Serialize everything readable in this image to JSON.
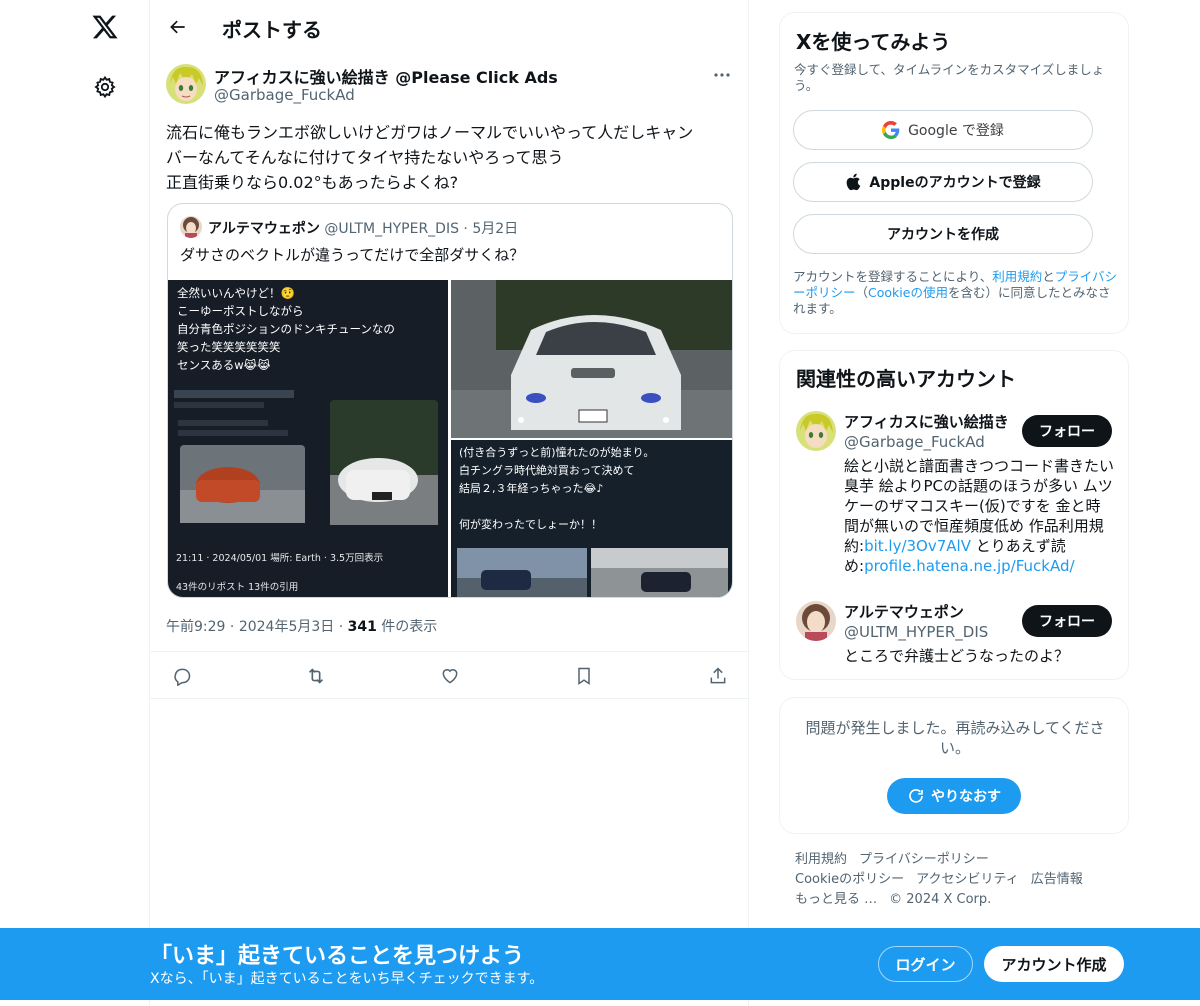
{
  "nav": {
    "logo_icon": "x-logo-icon",
    "settings_icon": "gear-icon"
  },
  "header": {
    "title": "ポストする",
    "back_icon": "arrow-left-icon"
  },
  "post": {
    "author_name": "アフィカスに強い絵描き @Please Click Ads",
    "author_handle": "@Garbage_FuckAd",
    "text_lines": [
      "流石に俺もランエボ欲しいけどガワはノーマルでいいやって人だしキャン",
      "バーなんてそんなに付けてタイヤ持たないやろって思う",
      "正直街乗りなら0.02°もあったらよくね?"
    ],
    "quote": {
      "name": "アルテマウェポン",
      "handle": "@ULTM_HYPER_DIS",
      "separator": "·",
      "date": "5月2日",
      "text": "ダサさのベクトルが違うってだけで全部ダサくね？",
      "media1_lines": [
        "全然いいんやけど！🤨",
        "こーゆーポストしながら",
        "自分青色ポジションのドンキチューンなの",
        "笑った笑笑笑笑笑笑",
        "センスあるw😹😹"
      ],
      "media1_footer": "21:11 · 2024/05/01 場所: Earth · 3.5万回表示",
      "media1_footer2": "43件のリポスト 13件の引用",
      "media3_lines": [
        "(付き合うずっと前)憧れたのが始まり。",
        "白チングラ時代絶対買おって決めて",
        "結局２,３年経っちゃった😂♪",
        "",
        "何が変わったでしょーか！！"
      ]
    },
    "time": "午前9:29",
    "date": "2024年5月3日",
    "views_count": "341",
    "views_label": " 件の表示",
    "dot": " · "
  },
  "actions": [
    "reply-icon",
    "repost-icon",
    "like-icon",
    "bookmark-icon",
    "share-icon"
  ],
  "signup_card": {
    "title": "Xを使ってみよう",
    "subtitle": "今すぐ登録して、タイムラインをカスタマイズしましょう。",
    "google": "Google で登録",
    "apple": "Appleのアカウントで登録",
    "create": "アカウントを作成",
    "terms_pre": "アカウントを登録することにより、",
    "terms_link1": "利用規約",
    "terms_and": "と",
    "terms_link2": "プライバシーポリシー",
    "terms_mid": "（",
    "terms_link3": "Cookieの使用",
    "terms_post": "を含む）に同意したとみなされます。"
  },
  "related": {
    "title": "関連性の高いアカウント",
    "accounts": [
      {
        "name": "アフィカスに強い絵描き",
        "handle": "@Garbage_FuckAd",
        "follow": "フォロー",
        "bio": "絵と小説と譜面書きつつコード書きたい臭芋 絵よりPCの話題のほうが多い ムツケーのザマコスキー(仮)ですを 金と時間が無いので恒産頻度低め 作品利用規約:",
        "link1": "bit.ly/3Ov7AlV",
        "bio2": " とりあえず読め:",
        "link2": "profile.hatena.ne.jp/FuckAd/"
      },
      {
        "name": "アルテマウェポン",
        "handle": "@ULTM_HYPER_DIS",
        "follow": "フォロー",
        "bio": "ところで弁護士どうなったのよ？"
      }
    ]
  },
  "error_card": {
    "text": "問題が発生しました。再読み込みしてください。",
    "retry": "やりなおす"
  },
  "footer": {
    "links": [
      "利用規約",
      "プライバシーポリシー",
      "Cookieのポリシー",
      "アクセシビリティ",
      "広告情報",
      "もっと見る …",
      "© 2024 X Corp."
    ]
  },
  "banner": {
    "title": "「いま」起きていることを見つけよう",
    "subtitle": "Xなら、「いま」起きていることをいち早くチェックできます。",
    "login": "ログイン",
    "signup": "アカウント作成"
  }
}
